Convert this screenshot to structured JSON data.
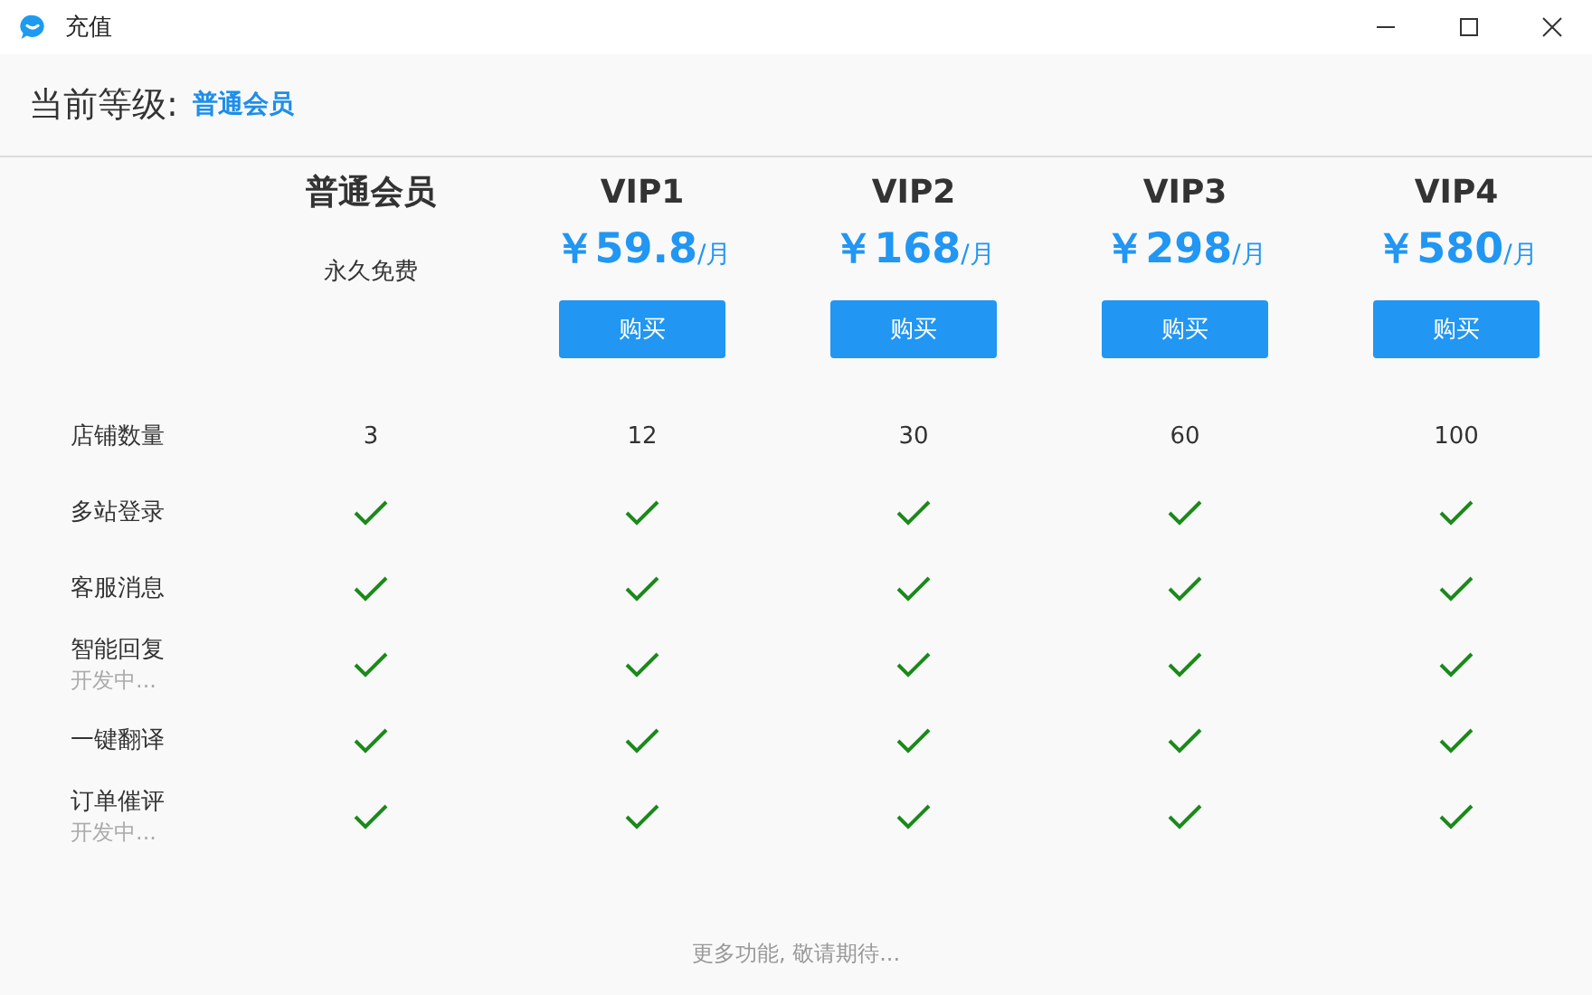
{
  "window": {
    "title": "充值"
  },
  "current_level": {
    "label": "当前等级:",
    "value": "普通会员"
  },
  "plans": [
    {
      "name": "普通会员",
      "subtitle": "永久免费"
    },
    {
      "name": "VIP1",
      "price": "￥59.8",
      "unit": "/月",
      "button": "购买"
    },
    {
      "name": "VIP2",
      "price": "￥168",
      "unit": "/月",
      "button": "购买"
    },
    {
      "name": "VIP3",
      "price": "￥298",
      "unit": "/月",
      "button": "购买"
    },
    {
      "name": "VIP4",
      "price": "￥580",
      "unit": "/月",
      "button": "购买"
    }
  ],
  "features": [
    {
      "label": "店铺数量",
      "cells": [
        {
          "kind": "text",
          "value": "3"
        },
        {
          "kind": "text",
          "value": "12"
        },
        {
          "kind": "text",
          "value": "30"
        },
        {
          "kind": "text",
          "value": "60"
        },
        {
          "kind": "text",
          "value": "100"
        }
      ]
    },
    {
      "label": "多站登录",
      "cells": [
        {
          "kind": "check",
          "checked": true
        },
        {
          "kind": "check",
          "checked": true
        },
        {
          "kind": "check",
          "checked": true
        },
        {
          "kind": "check",
          "checked": true
        },
        {
          "kind": "check",
          "checked": true
        }
      ]
    },
    {
      "label": "客服消息",
      "cells": [
        {
          "kind": "check",
          "checked": true
        },
        {
          "kind": "check",
          "checked": true
        },
        {
          "kind": "check",
          "checked": true
        },
        {
          "kind": "check",
          "checked": true
        },
        {
          "kind": "check",
          "checked": true
        }
      ]
    },
    {
      "label": "智能回复",
      "note": "开发中...",
      "cells": [
        {
          "kind": "check",
          "checked": true
        },
        {
          "kind": "check",
          "checked": true
        },
        {
          "kind": "check",
          "checked": true
        },
        {
          "kind": "check",
          "checked": true
        },
        {
          "kind": "check",
          "checked": true
        }
      ]
    },
    {
      "label": "一键翻译",
      "cells": [
        {
          "kind": "check",
          "checked": true
        },
        {
          "kind": "check",
          "checked": true
        },
        {
          "kind": "check",
          "checked": true
        },
        {
          "kind": "check",
          "checked": true
        },
        {
          "kind": "check",
          "checked": true
        }
      ]
    },
    {
      "label": "订单催评",
      "note": "开发中...",
      "cells": [
        {
          "kind": "check",
          "checked": true
        },
        {
          "kind": "check",
          "checked": true
        },
        {
          "kind": "check",
          "checked": true
        },
        {
          "kind": "check",
          "checked": true
        },
        {
          "kind": "check",
          "checked": true
        }
      ]
    }
  ],
  "footer": "更多功能, 敬请期待..."
}
